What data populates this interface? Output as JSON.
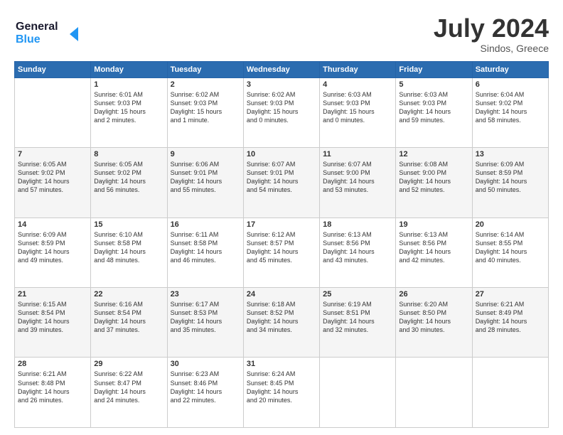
{
  "header": {
    "logo_line1": "General",
    "logo_line2": "Blue",
    "month": "July 2024",
    "location": "Sindos, Greece"
  },
  "weekdays": [
    "Sunday",
    "Monday",
    "Tuesday",
    "Wednesday",
    "Thursday",
    "Friday",
    "Saturday"
  ],
  "weeks": [
    [
      {
        "day": "",
        "lines": []
      },
      {
        "day": "1",
        "lines": [
          "Sunrise: 6:01 AM",
          "Sunset: 9:03 PM",
          "Daylight: 15 hours",
          "and 2 minutes."
        ]
      },
      {
        "day": "2",
        "lines": [
          "Sunrise: 6:02 AM",
          "Sunset: 9:03 PM",
          "Daylight: 15 hours",
          "and 1 minute."
        ]
      },
      {
        "day": "3",
        "lines": [
          "Sunrise: 6:02 AM",
          "Sunset: 9:03 PM",
          "Daylight: 15 hours",
          "and 0 minutes."
        ]
      },
      {
        "day": "4",
        "lines": [
          "Sunrise: 6:03 AM",
          "Sunset: 9:03 PM",
          "Daylight: 15 hours",
          "and 0 minutes."
        ]
      },
      {
        "day": "5",
        "lines": [
          "Sunrise: 6:03 AM",
          "Sunset: 9:03 PM",
          "Daylight: 14 hours",
          "and 59 minutes."
        ]
      },
      {
        "day": "6",
        "lines": [
          "Sunrise: 6:04 AM",
          "Sunset: 9:02 PM",
          "Daylight: 14 hours",
          "and 58 minutes."
        ]
      }
    ],
    [
      {
        "day": "7",
        "lines": [
          "Sunrise: 6:05 AM",
          "Sunset: 9:02 PM",
          "Daylight: 14 hours",
          "and 57 minutes."
        ]
      },
      {
        "day": "8",
        "lines": [
          "Sunrise: 6:05 AM",
          "Sunset: 9:02 PM",
          "Daylight: 14 hours",
          "and 56 minutes."
        ]
      },
      {
        "day": "9",
        "lines": [
          "Sunrise: 6:06 AM",
          "Sunset: 9:01 PM",
          "Daylight: 14 hours",
          "and 55 minutes."
        ]
      },
      {
        "day": "10",
        "lines": [
          "Sunrise: 6:07 AM",
          "Sunset: 9:01 PM",
          "Daylight: 14 hours",
          "and 54 minutes."
        ]
      },
      {
        "day": "11",
        "lines": [
          "Sunrise: 6:07 AM",
          "Sunset: 9:00 PM",
          "Daylight: 14 hours",
          "and 53 minutes."
        ]
      },
      {
        "day": "12",
        "lines": [
          "Sunrise: 6:08 AM",
          "Sunset: 9:00 PM",
          "Daylight: 14 hours",
          "and 52 minutes."
        ]
      },
      {
        "day": "13",
        "lines": [
          "Sunrise: 6:09 AM",
          "Sunset: 8:59 PM",
          "Daylight: 14 hours",
          "and 50 minutes."
        ]
      }
    ],
    [
      {
        "day": "14",
        "lines": [
          "Sunrise: 6:09 AM",
          "Sunset: 8:59 PM",
          "Daylight: 14 hours",
          "and 49 minutes."
        ]
      },
      {
        "day": "15",
        "lines": [
          "Sunrise: 6:10 AM",
          "Sunset: 8:58 PM",
          "Daylight: 14 hours",
          "and 48 minutes."
        ]
      },
      {
        "day": "16",
        "lines": [
          "Sunrise: 6:11 AM",
          "Sunset: 8:58 PM",
          "Daylight: 14 hours",
          "and 46 minutes."
        ]
      },
      {
        "day": "17",
        "lines": [
          "Sunrise: 6:12 AM",
          "Sunset: 8:57 PM",
          "Daylight: 14 hours",
          "and 45 minutes."
        ]
      },
      {
        "day": "18",
        "lines": [
          "Sunrise: 6:13 AM",
          "Sunset: 8:56 PM",
          "Daylight: 14 hours",
          "and 43 minutes."
        ]
      },
      {
        "day": "19",
        "lines": [
          "Sunrise: 6:13 AM",
          "Sunset: 8:56 PM",
          "Daylight: 14 hours",
          "and 42 minutes."
        ]
      },
      {
        "day": "20",
        "lines": [
          "Sunrise: 6:14 AM",
          "Sunset: 8:55 PM",
          "Daylight: 14 hours",
          "and 40 minutes."
        ]
      }
    ],
    [
      {
        "day": "21",
        "lines": [
          "Sunrise: 6:15 AM",
          "Sunset: 8:54 PM",
          "Daylight: 14 hours",
          "and 39 minutes."
        ]
      },
      {
        "day": "22",
        "lines": [
          "Sunrise: 6:16 AM",
          "Sunset: 8:54 PM",
          "Daylight: 14 hours",
          "and 37 minutes."
        ]
      },
      {
        "day": "23",
        "lines": [
          "Sunrise: 6:17 AM",
          "Sunset: 8:53 PM",
          "Daylight: 14 hours",
          "and 35 minutes."
        ]
      },
      {
        "day": "24",
        "lines": [
          "Sunrise: 6:18 AM",
          "Sunset: 8:52 PM",
          "Daylight: 14 hours",
          "and 34 minutes."
        ]
      },
      {
        "day": "25",
        "lines": [
          "Sunrise: 6:19 AM",
          "Sunset: 8:51 PM",
          "Daylight: 14 hours",
          "and 32 minutes."
        ]
      },
      {
        "day": "26",
        "lines": [
          "Sunrise: 6:20 AM",
          "Sunset: 8:50 PM",
          "Daylight: 14 hours",
          "and 30 minutes."
        ]
      },
      {
        "day": "27",
        "lines": [
          "Sunrise: 6:21 AM",
          "Sunset: 8:49 PM",
          "Daylight: 14 hours",
          "and 28 minutes."
        ]
      }
    ],
    [
      {
        "day": "28",
        "lines": [
          "Sunrise: 6:21 AM",
          "Sunset: 8:48 PM",
          "Daylight: 14 hours",
          "and 26 minutes."
        ]
      },
      {
        "day": "29",
        "lines": [
          "Sunrise: 6:22 AM",
          "Sunset: 8:47 PM",
          "Daylight: 14 hours",
          "and 24 minutes."
        ]
      },
      {
        "day": "30",
        "lines": [
          "Sunrise: 6:23 AM",
          "Sunset: 8:46 PM",
          "Daylight: 14 hours",
          "and 22 minutes."
        ]
      },
      {
        "day": "31",
        "lines": [
          "Sunrise: 6:24 AM",
          "Sunset: 8:45 PM",
          "Daylight: 14 hours",
          "and 20 minutes."
        ]
      },
      {
        "day": "",
        "lines": []
      },
      {
        "day": "",
        "lines": []
      },
      {
        "day": "",
        "lines": []
      }
    ]
  ]
}
